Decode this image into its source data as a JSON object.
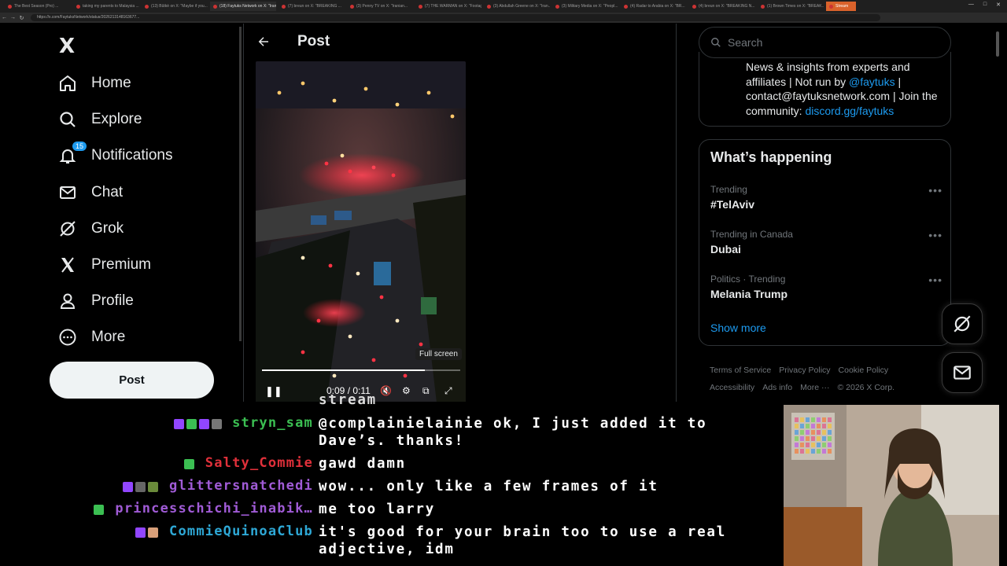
{
  "browser": {
    "tabs": [
      "The Best Season (Pro) ...",
      "taking my parents to Malaysia ...",
      "(13) Bûtkè on X: \"Maybe if you...",
      "(18) Faytuks Network on X: \"Iran...",
      "(7) breun on X: \"BREAKING ...",
      "(3) Penny TV on X: \"Iranian...",
      "(7) THE WARMAN on X: \"Footage...",
      "(3) Abdullah Greene on X: \"Iran...",
      "(3) Military Media on X: \"Peopl...",
      "(4) Radar to Arabia on X: \"BR...",
      "(4) breun on X: \"BREAKING N...",
      "(1) Brown Times on X: \"BREAK...",
      "Stream"
    ],
    "url": "https://x.com/FaytuksNetwork/status/2026213148163677..."
  },
  "nav": {
    "logo": "X",
    "items": [
      {
        "label": "Home",
        "icon": "home-icon"
      },
      {
        "label": "Explore",
        "icon": "search-icon"
      },
      {
        "label": "Notifications",
        "icon": "bell-icon",
        "badge": "15"
      },
      {
        "label": "Chat",
        "icon": "mail-icon"
      },
      {
        "label": "Grok",
        "icon": "grok-icon"
      },
      {
        "label": "Premium",
        "icon": "x-icon"
      },
      {
        "label": "Profile",
        "icon": "person-icon"
      },
      {
        "label": "More",
        "icon": "more-circle-icon"
      }
    ],
    "post_button": "Post"
  },
  "post": {
    "title": "Post",
    "video": {
      "time": "0:09 / 0:11",
      "progress": 0.82,
      "tooltip": "Full screen"
    }
  },
  "sidebar": {
    "search_placeholder": "Search",
    "bio": {
      "text": "News & insights from experts and affiliates | Not run by ",
      "handle": "@faytuks",
      "text2": " | contact@faytuksnetwork.com | Join the community: ",
      "discord": "discord.gg/faytuks"
    },
    "trending_title": "What’s happening",
    "trends": [
      {
        "context": "Trending",
        "name": "#TelAviv"
      },
      {
        "context": "Trending in Canada",
        "name": "Dubai"
      },
      {
        "context": "Politics · Trending",
        "name": "Melania Trump"
      }
    ],
    "show_more": "Show more",
    "footer": [
      "Terms of Service",
      "Privacy Policy",
      "Cookie Policy",
      "Accessibility",
      "Ads info",
      "More ···",
      "© 2026 X Corp."
    ]
  },
  "chat": {
    "partial_top": "stream",
    "messages": [
      {
        "user": "stryn_sam",
        "color": "#3bbf52",
        "text": "@complainielainie ok, I just added it to Dave’s. thanks!"
      },
      {
        "user": "Salty_Commie",
        "color": "#e0303a",
        "text": "gawd damn"
      },
      {
        "user": "glittersnatchedi",
        "color": "#a05bd6",
        "text": "wow... only like a few frames of it"
      },
      {
        "user": "princesschichi_inabik…",
        "color": "#a05bd6",
        "text": "me too larry"
      },
      {
        "user": "CommieQuinoaClub",
        "color": "#2ea8d6",
        "text": "it's good for your brain too to use a real adjective, idm"
      }
    ]
  },
  "colors": {
    "accent": "#1d9bf0",
    "background": "#000000",
    "border": "#2f3336"
  }
}
